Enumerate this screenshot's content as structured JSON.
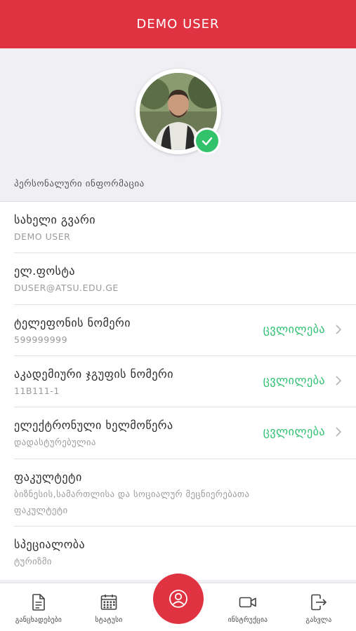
{
  "header": {
    "title": "DEMO USER"
  },
  "profile": {
    "section_label": "პერსონალური ინფორმაცია",
    "verified_color": "#33c26c"
  },
  "rows": [
    {
      "title": "სახელი გვარი",
      "value": "DEMO USER",
      "action": ""
    },
    {
      "title": "ელ.ფოსტა",
      "value": "DUSER@ATSU.EDU.GE",
      "action": ""
    },
    {
      "title": "ტელეფონის ნომერი",
      "value": "599999999",
      "action": "ცვლილება"
    },
    {
      "title": "აკადემიური ჯგუფის ნომერი",
      "value": "11B111-1",
      "action": "ცვლილება"
    },
    {
      "title": "ელექტრონული ხელმოწერა",
      "value": "დადასტურებულია",
      "action": "ცვლილება"
    },
    {
      "title": "ფაკულტეტი",
      "value_line1": "ბიზნესის,სამართლისა და სოციალურ მეცნიერებათა",
      "value_line2": "ფაკულტეტი",
      "action": ""
    },
    {
      "title": "სპეციალობა",
      "value": "ტურიზმი",
      "action": ""
    }
  ],
  "tabbar": {
    "items": [
      {
        "label": "განცხადებები",
        "icon": "document-icon"
      },
      {
        "label": "სტატუსი",
        "icon": "calendar-icon"
      },
      {
        "label": "",
        "icon": "profile-icon"
      },
      {
        "label": "ინსტრუქცია",
        "icon": "video-icon"
      },
      {
        "label": "გასვლა",
        "icon": "logout-icon"
      }
    ]
  },
  "colors": {
    "accent": "#e03342",
    "action_green": "#2ec070",
    "background": "#efeff4"
  }
}
